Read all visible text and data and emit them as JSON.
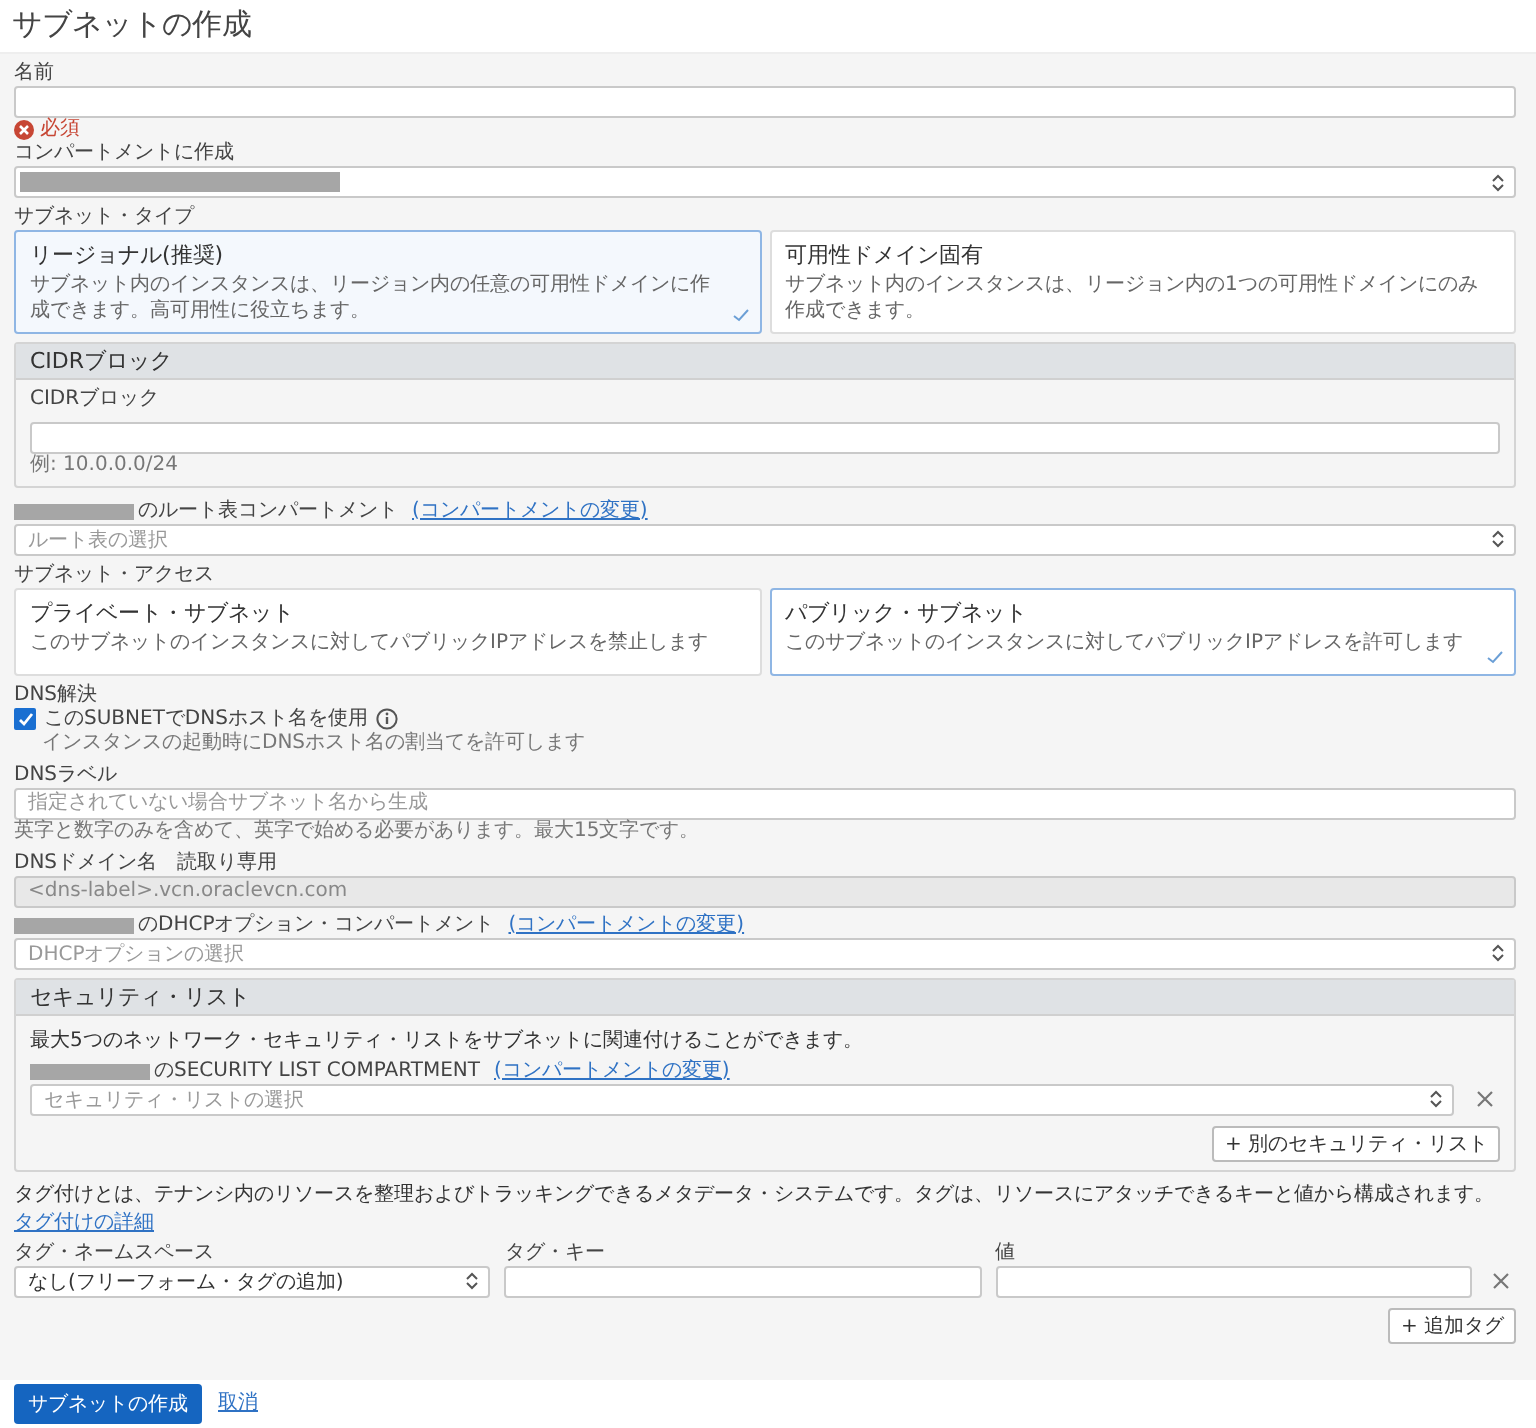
{
  "title": "サブネットの作成",
  "name_field": {
    "label": "名前",
    "error": "必須"
  },
  "compartment": {
    "label": "コンパートメントに作成",
    "redacted": true
  },
  "subnet_type": {
    "label": "サブネット・タイプ",
    "options": [
      {
        "title": "リージョナル(推奨)",
        "description": "サブネット内のインスタンスは、リージョン内の任意の可用性ドメインに作成できます。高可用性に役立ちます。",
        "selected": true
      },
      {
        "title": "可用性ドメイン固有",
        "description": "サブネット内のインスタンスは、リージョン内の1つの可用性ドメインにのみ作成できます。",
        "selected": false
      }
    ]
  },
  "cidr": {
    "heading": "CIDRブロック",
    "label": "CIDRブロック",
    "hint": "例: 10.0.0.0/24"
  },
  "route_table": {
    "label": "のルート表コンパートメント",
    "link": "(コンパートメントの変更)",
    "placeholder": "ルート表の選択"
  },
  "subnet_access": {
    "label": "サブネット・アクセス",
    "options": [
      {
        "title": "プライベート・サブネット",
        "description": "このサブネットのインスタンスに対してパブリックIPアドレスを禁止します",
        "selected": false
      },
      {
        "title": "パブリック・サブネット",
        "description": "このサブネットのインスタンスに対してパブリックIPアドレスを許可します",
        "selected": true
      }
    ]
  },
  "dns_resolution": {
    "label": "DNS解決",
    "checkbox_label": "このSUBNETでDNSホスト名を使用",
    "checked": true,
    "help": "インスタンスの起動時にDNSホスト名の割当てを許可します"
  },
  "dns_label": {
    "label": "DNSラベル",
    "placeholder": "指定されていない場合サブネット名から生成",
    "hint": "英字と数字のみを含めて、英字で始める必要があります。最大15文字です。"
  },
  "dns_domain": {
    "label": "DNSドメイン名　読取り専用",
    "value": "<dns-label>.vcn.oraclevcn.com"
  },
  "dhcp": {
    "label": "のDHCPオプション・コンパートメント",
    "link": "(コンパートメントの変更)",
    "placeholder": "DHCPオプションの選択"
  },
  "security_list": {
    "heading": "セキュリティ・リスト",
    "description": "最大5つのネットワーク・セキュリティ・リストをサブネットに関連付けることができます。",
    "label": "のSECURITY LIST COMPARTMENT",
    "link": "(コンパートメントの変更)",
    "placeholder": "セキュリティ・リストの選択",
    "add_button": "+ 別のセキュリティ・リスト"
  },
  "tags": {
    "description": "タグ付けとは、テナンシ内のリソースを整理およびトラッキングできるメタデータ・システムです。タグは、リソースにアタッチできるキーと値から構成されます。",
    "link": "タグ付けの詳細",
    "namespace": {
      "label": "タグ・ネームスペース",
      "value": "なし(フリーフォーム・タグの追加)"
    },
    "key": {
      "label": "タグ・キー"
    },
    "value": {
      "label": "値"
    },
    "add_button": "+ 追加タグ"
  },
  "footer": {
    "create_button": "サブネットの作成",
    "cancel_link": "取消"
  }
}
